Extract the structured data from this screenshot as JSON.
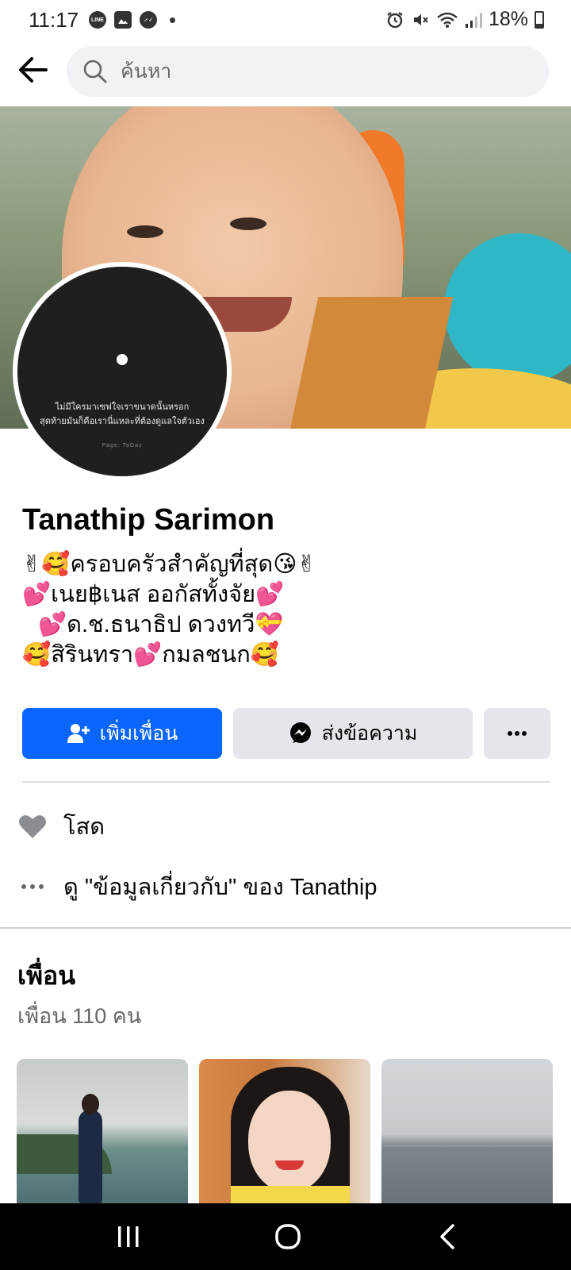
{
  "status_bar": {
    "time": "11:17",
    "left_icons": [
      "line-app-icon",
      "gallery-icon",
      "messenger-icon"
    ],
    "battery": "18%"
  },
  "search": {
    "placeholder": "ค้นหา"
  },
  "avatar": {
    "quote_line1": "ไม่มีใครมาเซฟใจเราขนาดนั้นหรอก",
    "quote_line2": "สุดท้ายมันก็คือเรานี่แหละที่ต้องดูแลใจตัวเอง",
    "brand": "Page: ToDay"
  },
  "profile": {
    "name": "Tanathip Sarimon",
    "bio": [
      "✌🥰ครอบครัวสำคัญที่สุด😘✌",
      "💕เนย฿เนส ออกัสทั้งจัย💕",
      "  💕ด.ช.ธนาธิป ดวงทวี💝",
      "🥰สิรินทรา💕กมลชนก🥰"
    ]
  },
  "actions": {
    "add_friend": "เพิ่มเพื่อน",
    "message": "ส่งข้อความ"
  },
  "intro": {
    "relationship": "โสด",
    "about_link": "ดู \"ข้อมูลเกี่ยวกับ\" ของ Tanathip"
  },
  "friends": {
    "title": "เพื่อน",
    "count": "เพื่อน 110 คน"
  },
  "colors": {
    "primary_blue": "#0866ff",
    "secondary_button": "#e4e6eb",
    "search_bg": "#f0f2f5",
    "muted_text": "#65676b"
  }
}
